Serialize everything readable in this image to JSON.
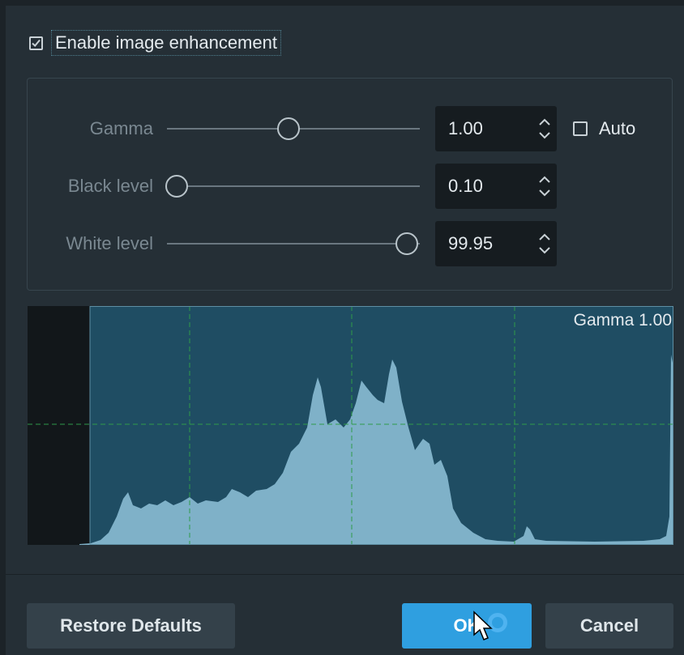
{
  "enable": {
    "label": "Enable image enhancement",
    "checked": true
  },
  "params": [
    {
      "label": "Gamma",
      "value": "1.00",
      "slider_fraction": 0.48
    },
    {
      "label": "Black level",
      "value": "0.10",
      "slider_fraction": 0.04
    },
    {
      "label": "White level",
      "value": "99.95",
      "slider_fraction": 0.95
    }
  ],
  "auto": {
    "label": "Auto",
    "checked": false
  },
  "histogram": {
    "label": "Gamma 1.00"
  },
  "buttons": {
    "restore": "Restore Defaults",
    "ok": "OK",
    "cancel": "Cancel"
  },
  "colors": {
    "accent": "#2f9fe0",
    "hist_fill": "#7fb1c8",
    "hist_bg": "#1f4d63",
    "grid": "#2f9a4a"
  }
}
